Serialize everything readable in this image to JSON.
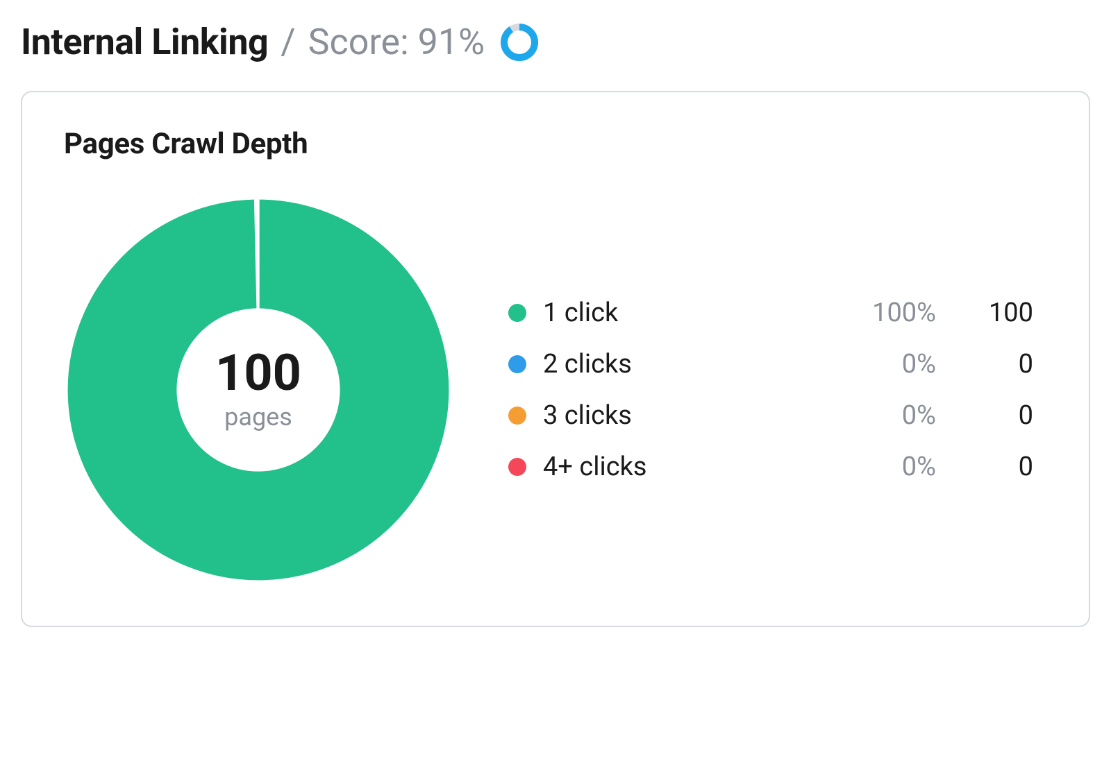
{
  "header": {
    "title": "Internal Linking",
    "separator": "/",
    "score_label": "Score: 91%",
    "score_percent": 91
  },
  "card": {
    "title": "Pages Crawl Depth",
    "center_value": "100",
    "center_unit": "pages"
  },
  "colors": {
    "green": "#22c08b",
    "blue": "#2f9ce9",
    "orange": "#f59d33",
    "red": "#f5475a",
    "ring_accent": "#1ea7ea",
    "ring_track": "#d6dae0"
  },
  "legend": [
    {
      "label": "1 click",
      "pct": "100%",
      "count": "100",
      "color_key": "green"
    },
    {
      "label": "2 clicks",
      "pct": "0%",
      "count": "0",
      "color_key": "blue"
    },
    {
      "label": "3 clicks",
      "pct": "0%",
      "count": "0",
      "color_key": "orange"
    },
    {
      "label": "4+ clicks",
      "pct": "0%",
      "count": "0",
      "color_key": "red"
    }
  ],
  "chart_data": {
    "type": "pie",
    "title": "Pages Crawl Depth",
    "categories": [
      "1 click",
      "2 clicks",
      "3 clicks",
      "4+ clicks"
    ],
    "values": [
      100,
      0,
      0,
      0
    ],
    "percentages": [
      100,
      0,
      0,
      0
    ],
    "total": 100,
    "unit": "pages",
    "series": [
      {
        "name": "1 click",
        "value": 100,
        "percent": 100,
        "color": "#22c08b"
      },
      {
        "name": "2 clicks",
        "value": 0,
        "percent": 0,
        "color": "#2f9ce9"
      },
      {
        "name": "3 clicks",
        "value": 0,
        "percent": 0,
        "color": "#f59d33"
      },
      {
        "name": "4+ clicks",
        "value": 0,
        "percent": 0,
        "color": "#f5475a"
      }
    ]
  }
}
